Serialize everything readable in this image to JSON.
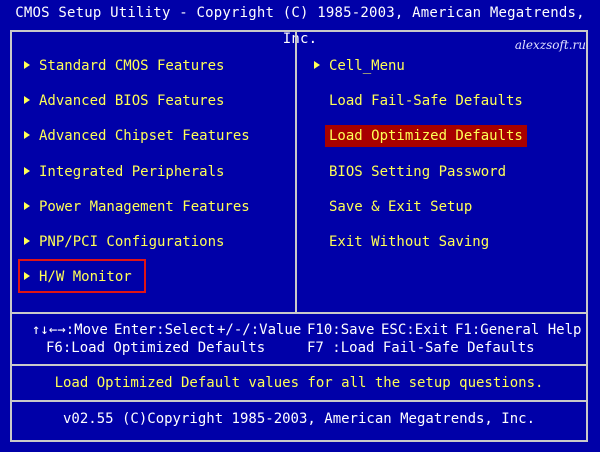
{
  "title": "CMOS Setup Utility - Copyright (C) 1985-2003, American Megatrends, Inc.",
  "watermark": "alexzsoft.ru",
  "left_menu": [
    {
      "label": "Standard CMOS Features",
      "submenu": true
    },
    {
      "label": "Advanced BIOS Features",
      "submenu": true
    },
    {
      "label": "Advanced Chipset Features",
      "submenu": true
    },
    {
      "label": "Integrated Peripherals",
      "submenu": true
    },
    {
      "label": "Power Management Features",
      "submenu": true
    },
    {
      "label": "PNP/PCI Configurations",
      "submenu": true
    },
    {
      "label": "H/W Monitor",
      "submenu": true,
      "annotated": true
    }
  ],
  "right_menu": [
    {
      "label": "Cell_Menu",
      "submenu": true
    },
    {
      "label": "Load Fail-Safe Defaults",
      "submenu": false
    },
    {
      "label": "Load Optimized Defaults",
      "submenu": false,
      "selected": true
    },
    {
      "label": "BIOS Setting Password",
      "submenu": false
    },
    {
      "label": "Save & Exit Setup",
      "submenu": false
    },
    {
      "label": "Exit Without Saving",
      "submenu": false
    }
  ],
  "help": {
    "move": "↑↓←→:Move",
    "select": "Enter:Select",
    "value": "+/-/:Value",
    "save": "F10:Save",
    "exit": "ESC:Exit",
    "general_help": "F1:General Help",
    "f6": "F6:Load Optimized Defaults",
    "f7": "F7 :Load Fail-Safe Defaults"
  },
  "status_text": "Load Optimized Default values for all the setup questions.",
  "version_text": "v02.55 (C)Copyright 1985-2003, American Megatrends, Inc.",
  "colors": {
    "background": "#0000a8",
    "menu_text": "#ffff55",
    "selected_bg": "#a80000",
    "annotation_box": "#e01515",
    "frame": "#c9c9c9"
  }
}
